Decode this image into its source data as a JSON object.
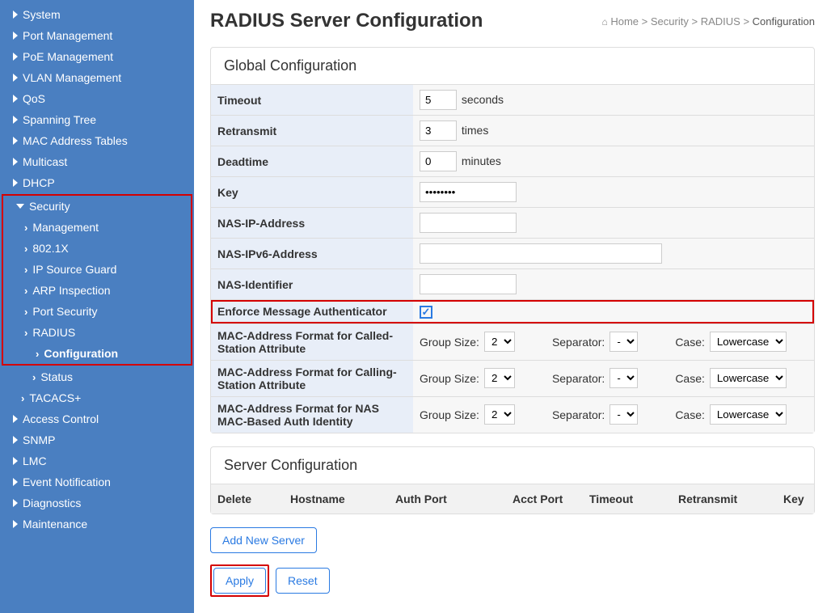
{
  "sidebar": {
    "items": [
      {
        "label": "System",
        "level": 0,
        "caret": "right"
      },
      {
        "label": "Port Management",
        "level": 0,
        "caret": "right"
      },
      {
        "label": "PoE Management",
        "level": 0,
        "caret": "right"
      },
      {
        "label": "VLAN Management",
        "level": 0,
        "caret": "right"
      },
      {
        "label": "QoS",
        "level": 0,
        "caret": "right"
      },
      {
        "label": "Spanning Tree",
        "level": 0,
        "caret": "right"
      },
      {
        "label": "MAC Address Tables",
        "level": 0,
        "caret": "right"
      },
      {
        "label": "Multicast",
        "level": 0,
        "caret": "right"
      },
      {
        "label": "DHCP",
        "level": 0,
        "caret": "right"
      }
    ],
    "security_group": {
      "label": "Security",
      "children": [
        {
          "label": "Management"
        },
        {
          "label": "802.1X"
        },
        {
          "label": "IP Source Guard"
        },
        {
          "label": "ARP Inspection"
        },
        {
          "label": "Port Security"
        }
      ],
      "radius": {
        "label": "RADIUS",
        "config": "Configuration",
        "status": "Status"
      }
    },
    "tacacs": "TACACS+",
    "rest": [
      {
        "label": "Access Control"
      },
      {
        "label": "SNMP"
      },
      {
        "label": "LMC"
      },
      {
        "label": "Event Notification"
      },
      {
        "label": "Diagnostics"
      },
      {
        "label": "Maintenance"
      }
    ]
  },
  "page_title": "RADIUS Server Configuration",
  "breadcrumb": {
    "home": "Home",
    "sep": ">",
    "b1": "Security",
    "b2": "RADIUS",
    "cur": "Configuration"
  },
  "global": {
    "title": "Global Configuration",
    "timeout_label": "Timeout",
    "timeout_value": "5",
    "timeout_unit": "seconds",
    "retransmit_label": "Retransmit",
    "retransmit_value": "3",
    "retransmit_unit": "times",
    "deadtime_label": "Deadtime",
    "deadtime_value": "0",
    "deadtime_unit": "minutes",
    "key_label": "Key",
    "key_value": "********",
    "nasip_label": "NAS-IP-Address",
    "nasip_value": "",
    "nasipv6_label": "NAS-IPv6-Address",
    "nasipv6_value": "",
    "nasid_label": "NAS-Identifier",
    "nasid_value": "",
    "enforce_label": "Enforce Message Authenticator",
    "enforce_checked": true,
    "mac1_label": "MAC-Address Format for Called-Station Attribute",
    "mac2_label": "MAC-Address Format for Calling-Station Attribute",
    "mac3_label": "MAC-Address Format for NAS MAC-Based Auth Identity",
    "group_size_label": "Group Size:",
    "group_size_value": "2",
    "separator_label": "Separator:",
    "separator_value": "-",
    "case_label": "Case:",
    "case_value": "Lowercase"
  },
  "server": {
    "title": "Server Configuration",
    "cols": {
      "delete": "Delete",
      "hostname": "Hostname",
      "auth": "Auth Port",
      "acct": "Acct Port",
      "timeout": "Timeout",
      "retransmit": "Retransmit",
      "key": "Key"
    }
  },
  "buttons": {
    "add": "Add New Server",
    "apply": "Apply",
    "reset": "Reset"
  }
}
